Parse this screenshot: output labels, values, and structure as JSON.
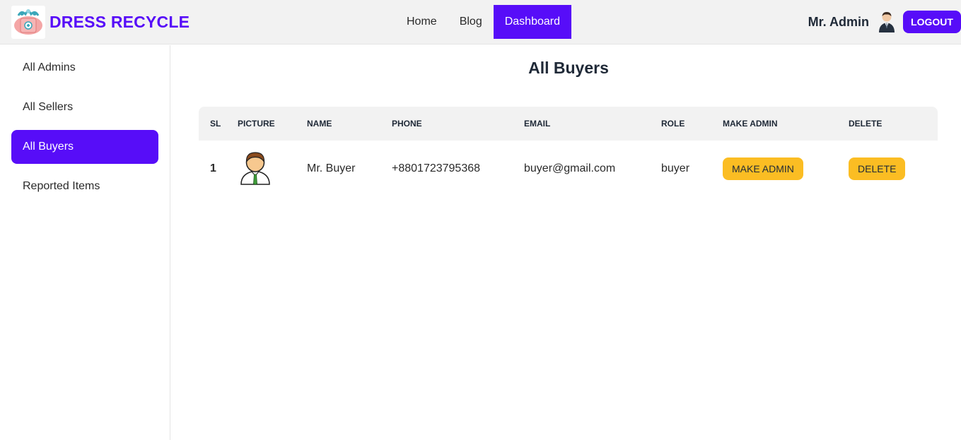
{
  "app": {
    "title": "DRESS RECYCLE",
    "colors": {
      "primary": "#570df8",
      "warning": "#fbbd23",
      "header_bg": "#f2f2f2"
    }
  },
  "nav": {
    "links": [
      {
        "label": "Home"
      },
      {
        "label": "Blog"
      },
      {
        "label": "Dashboard",
        "active": true
      }
    ]
  },
  "user": {
    "name": "Mr. Admin",
    "avatar_icon": "businessman-avatar-icon",
    "logout_label": "LOGOUT"
  },
  "sidebar": {
    "items": [
      {
        "label": "All Admins"
      },
      {
        "label": "All Sellers"
      },
      {
        "label": "All Buyers",
        "active": true
      },
      {
        "label": "Reported Items"
      }
    ]
  },
  "main": {
    "title": "All Buyers",
    "table": {
      "headers": [
        "SL",
        "PICTURE",
        "NAME",
        "PHONE",
        "EMAIL",
        "ROLE",
        "MAKE ADMIN",
        "DELETE"
      ],
      "rows": [
        {
          "sl": "1",
          "picture_icon": "user-avatar-icon",
          "name": "Mr. Buyer",
          "phone": "+8801723795368",
          "email": "buyer@gmail.com",
          "role": "buyer",
          "make_admin_label": "MAKE ADMIN",
          "delete_label": "DELETE"
        }
      ]
    }
  }
}
